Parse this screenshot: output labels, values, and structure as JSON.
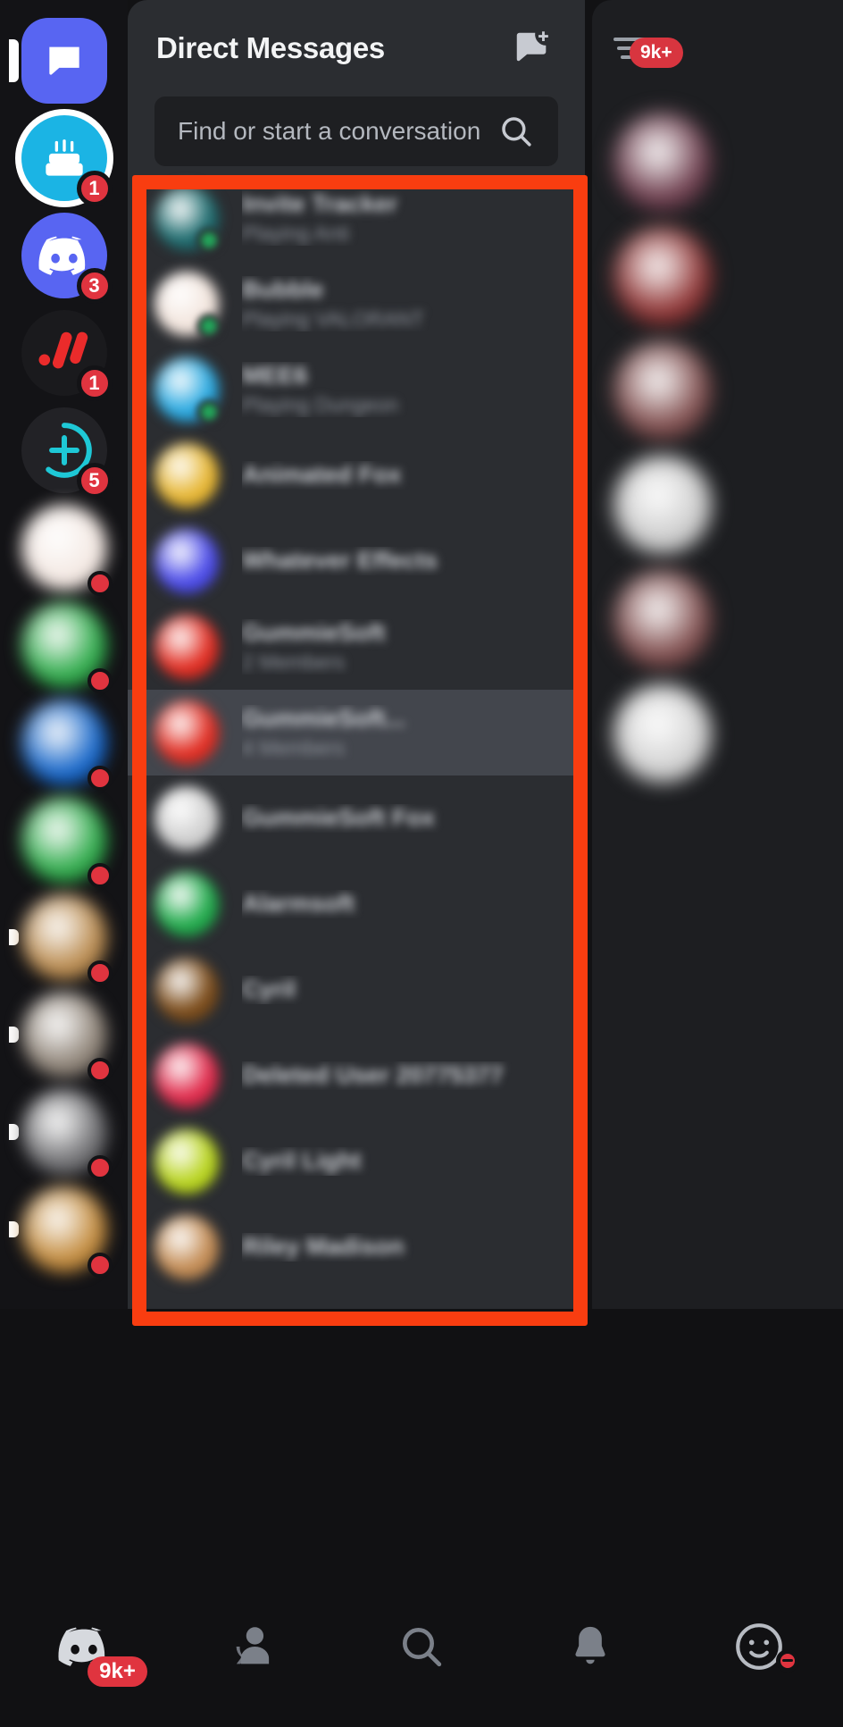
{
  "app": {
    "name": "Discord",
    "screen": "Direct Messages"
  },
  "server_rail": {
    "items": [
      {
        "name": "direct-messages",
        "label": "Direct Messages",
        "icon": "chat-bubble-icon",
        "shape": "squircle",
        "color": "#5865f2",
        "selected": true,
        "badge": ""
      },
      {
        "name": "birthday-server",
        "label": "Birthday Server",
        "icon": "cake-icon",
        "shape": "circle",
        "color": "#1bb4e4",
        "selected": false,
        "badge": "1"
      },
      {
        "name": "discord-server",
        "label": "Discord Server",
        "icon": "discord-logo-icon",
        "shape": "circle",
        "color": "#5865f2",
        "selected": false,
        "badge": "3"
      },
      {
        "name": "red-logo-server",
        "label": "Red Logo Server",
        "icon": "red-stripes-icon",
        "shape": "circle",
        "color": "#1a1a1d",
        "selected": false,
        "badge": "1"
      },
      {
        "name": "add-server",
        "label": "Add a Server",
        "icon": "plus-circle-icon",
        "shape": "circle",
        "color": "#222226",
        "selected": false,
        "badge": "5"
      },
      {
        "name": "server-6",
        "label": "",
        "icon": "server-avatar",
        "shape": "circle",
        "color": "#f3e8e2",
        "selected": false,
        "badge": "•"
      },
      {
        "name": "server-7",
        "label": "",
        "icon": "server-avatar",
        "shape": "circle",
        "color": "#2eaa4a",
        "selected": false,
        "badge": "•"
      },
      {
        "name": "server-8",
        "label": "",
        "icon": "server-avatar",
        "shape": "circle",
        "color": "#1565c8",
        "selected": false,
        "badge": "•"
      },
      {
        "name": "server-9",
        "label": "",
        "icon": "server-avatar",
        "shape": "circle",
        "color": "#2eaa4a",
        "selected": false,
        "badge": "•"
      },
      {
        "name": "server-10",
        "label": "",
        "icon": "server-avatar",
        "shape": "circle",
        "color": "#b98a4e",
        "selected": false,
        "badge": "•"
      },
      {
        "name": "server-11",
        "label": "",
        "icon": "server-avatar",
        "shape": "circle",
        "color": "#8e8377",
        "selected": false,
        "badge": "•"
      },
      {
        "name": "server-12",
        "label": "",
        "icon": "server-avatar",
        "shape": "circle",
        "color": "#6f6f72",
        "selected": false,
        "badge": "•"
      },
      {
        "name": "server-13",
        "label": "",
        "icon": "server-avatar",
        "shape": "circle",
        "color": "#c28a3c",
        "selected": false,
        "badge": "•"
      }
    ]
  },
  "dm_panel": {
    "title": "Direct Messages",
    "new_dm_icon": "new-message-icon",
    "search": {
      "placeholder": "Find or start a conversation",
      "value": "",
      "icon": "search-icon"
    },
    "rows": [
      {
        "name": "Invite Tracker",
        "subtitle": "Playing Anti",
        "avatar": "#1d6b6e",
        "presence": "#23a55a",
        "selected": false
      },
      {
        "name": "Bubble",
        "subtitle": "Playing VALORANT",
        "avatar": "#f2e5dd",
        "presence": "#23a55a",
        "selected": false
      },
      {
        "name": "MEE6",
        "subtitle": "Playing Dungeon",
        "avatar": "#28a8e0",
        "presence": "#23a55a",
        "selected": false
      },
      {
        "name": "Animated Fox",
        "subtitle": "",
        "avatar": "#e6b531",
        "presence": "",
        "selected": false
      },
      {
        "name": "Whatever Effects",
        "subtitle": "",
        "avatar": "#4a4ae8",
        "presence": "",
        "selected": false
      },
      {
        "name": "GummieSoft",
        "subtitle": "2 Members",
        "avatar": "#e02b20",
        "presence": "",
        "selected": false
      },
      {
        "name": "GummieSoft...",
        "subtitle": "4 Members",
        "avatar": "#e02b20",
        "presence": "",
        "selected": true
      },
      {
        "name": "GummieSoft Fox",
        "subtitle": "",
        "avatar": "#cfcfcf",
        "presence": "",
        "selected": false
      },
      {
        "name": "Alarmsoft",
        "subtitle": "",
        "avatar": "#1fa94a",
        "presence": "",
        "selected": false
      },
      {
        "name": "Cyril",
        "subtitle": "",
        "avatar": "#7a4a18",
        "presence": "",
        "selected": false
      },
      {
        "name": "Deleted User 20775377",
        "subtitle": "",
        "avatar": "#e0294a",
        "presence": "",
        "selected": false
      },
      {
        "name": "Cyril Light",
        "subtitle": "",
        "avatar": "#b7d31c",
        "presence": "",
        "selected": false
      },
      {
        "name": "Riley Madison",
        "subtitle": "",
        "avatar": "#c28a52",
        "presence": "",
        "selected": false
      }
    ]
  },
  "peek_panel": {
    "menu_icon": "list-filter-icon",
    "badge": "9k+",
    "avatars": [
      "#6b3a4a",
      "#8c3030",
      "#7d4a4a",
      "#c9c9c9",
      "#7d4a4a",
      "#cfcfcf"
    ]
  },
  "annotation": {
    "shape": "rectangle",
    "color": "#f93d10",
    "target": "direct-messages-list"
  },
  "bottom_nav": {
    "items": [
      {
        "name": "home-tab",
        "icon": "discord-logo-icon",
        "badge": "9k+",
        "active": true
      },
      {
        "name": "friends-tab",
        "icon": "friends-icon",
        "badge": "",
        "active": false
      },
      {
        "name": "search-tab",
        "icon": "search-icon",
        "badge": "",
        "active": false
      },
      {
        "name": "notifications-tab",
        "icon": "bell-icon",
        "badge": "",
        "active": false
      },
      {
        "name": "profile-tab",
        "icon": "user-avatar-icon",
        "badge": "",
        "active": false,
        "status": "dnd"
      }
    ]
  }
}
